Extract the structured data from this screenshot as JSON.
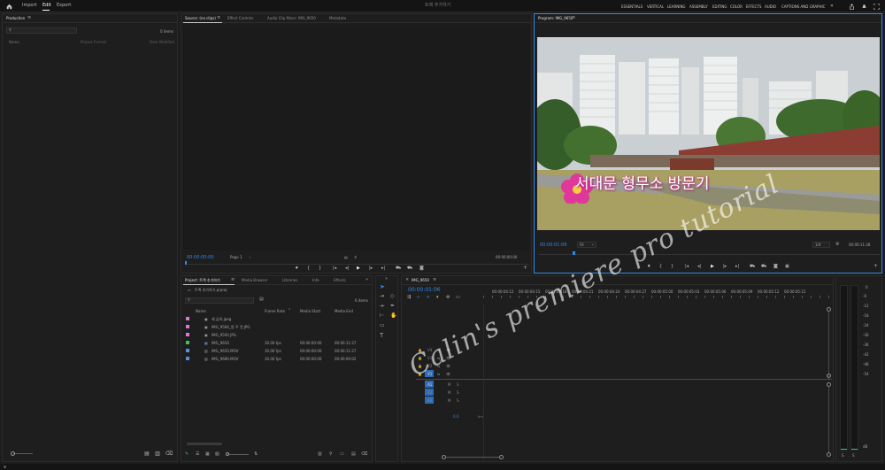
{
  "topbar": {
    "menu": [
      "Import",
      "Edit",
      "Export"
    ],
    "title": "트랙 추가하기",
    "workspaces": [
      "ESSENTIALS",
      "VERTICAL",
      "LEARNING",
      "ASSEMBLY",
      "EDITING",
      "COLOR",
      "EFFECTS",
      "AUDIO",
      "CAPTIONS AND GRAPHIC"
    ]
  },
  "production": {
    "title": "Production",
    "count": "0 items",
    "columns": [
      "Name",
      "Project Format",
      "Date Modified"
    ]
  },
  "source": {
    "tabs": [
      "Source: (no clips)",
      "Effect Controls",
      "Audio Clip Mixer: IMG_9650",
      "Metadata"
    ],
    "timecode_left": "00:00:00:00",
    "page": "Page 1",
    "timecode_right": "00:00:00:00"
  },
  "program": {
    "tab": "Program: IMG_9650",
    "caption": "서대문 형무소 방문기",
    "timecode_left": "00:00:01:06",
    "fit": "Fit",
    "ratio": "1/4",
    "timecode_right": "00:00:11:28"
  },
  "project": {
    "tabs": [
      "Project: 트랙 추가하기",
      "Media Browser",
      "Libraries",
      "Info",
      "Effects"
    ],
    "path": "트랙 추가하기.prproj",
    "count": "6 items",
    "columns": [
      "Name",
      "Frame Rate",
      "Media Start",
      "Media End"
    ],
    "items": [
      {
        "name": "제 습하.jpeg",
        "rate": "",
        "start": "",
        "end": "",
        "color": "#d978d9"
      },
      {
        "name": "IMG_9584_원 주 전.JPG",
        "rate": "",
        "start": "",
        "end": "",
        "color": "#d978d9"
      },
      {
        "name": "IMG_9592.JPG",
        "rate": "",
        "start": "",
        "end": "",
        "color": "#d978d9"
      },
      {
        "name": "IMG_9650",
        "rate": "30.00 fps",
        "start": "00:00:00:00",
        "end": "00:00:11:27",
        "color": "#3ec05a"
      },
      {
        "name": "IMG_9650.MOV",
        "rate": "30.00 fps",
        "start": "00:00:00:00",
        "end": "00:00:11:27",
        "color": "#5a8ee0"
      },
      {
        "name": "IMG_9680.MOV",
        "rate": "30.00 fps",
        "start": "00:00:00:00",
        "end": "00:00:09:02",
        "color": "#5a8ee0"
      }
    ]
  },
  "timeline": {
    "tab": "IMG_9650",
    "timecode": "00:00:01:06",
    "ruler": [
      "00:00:04:12",
      "00:00:04:15",
      "00:00:04:18",
      "00:00:04:21",
      "00:00:04:24",
      "00:00:04:27",
      "00:00:05:00",
      "00:00:05:03",
      "00:00:05:06",
      "00:00:05:09",
      "00:00:05:12",
      "00:00:05:15"
    ],
    "video_tracks": [
      "V4",
      "V3",
      "V2",
      "V1"
    ],
    "audio_tracks": [
      "A1",
      "A2",
      "A3"
    ],
    "mix_value": "0.0",
    "watermark": "Calin's premiere pro tutorial"
  },
  "meter": {
    "scale": [
      "0",
      "-6",
      "-12",
      "-18",
      "-24",
      "-30",
      "-36",
      "-42",
      "-48",
      "-54",
      "dB"
    ],
    "channels": [
      "S",
      "S"
    ]
  },
  "colors": {
    "accent": "#2d8ceb",
    "panel_bg": "#1e1e1e",
    "app_bg": "#111111",
    "caption_flower": "#e0389a"
  }
}
